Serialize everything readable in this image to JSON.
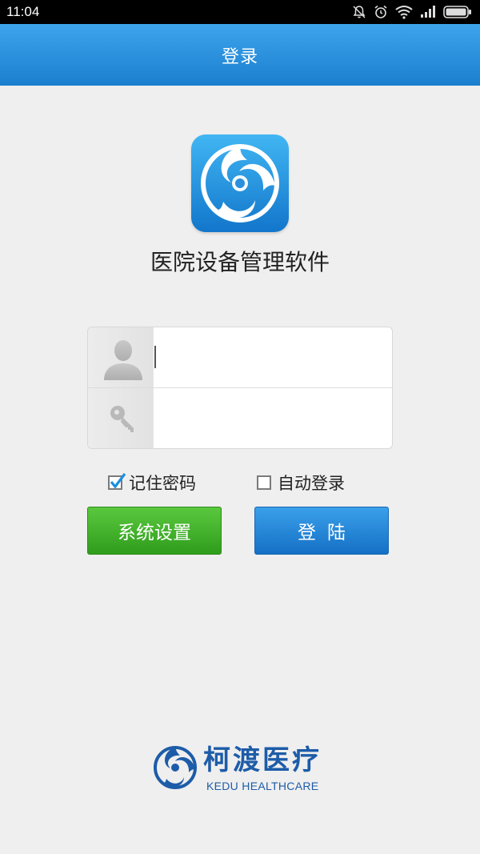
{
  "status_bar": {
    "time": "11:04",
    "icons": [
      "notifications-off-icon",
      "alarm-clock-icon",
      "wifi-icon",
      "signal-icon",
      "battery-icon"
    ]
  },
  "header": {
    "title": "登录"
  },
  "app": {
    "icon": "app-logo-icon",
    "name": "医院设备管理软件"
  },
  "login_form": {
    "username": {
      "icon": "user-icon",
      "value": "",
      "placeholder": ""
    },
    "password": {
      "icon": "key-icon",
      "value": "",
      "placeholder": ""
    }
  },
  "options": {
    "remember_password": {
      "label": "记住密码",
      "checked": true
    },
    "auto_login": {
      "label": "自动登录",
      "checked": false
    }
  },
  "buttons": {
    "settings": "系统设置",
    "login": "登陆"
  },
  "footer": {
    "brand_name": "柯渡医疗",
    "brand_english": "KEDU HEALTHCARE"
  },
  "colors": {
    "header_blue": "#2a8fdd",
    "login_blue": "#1e80d2",
    "settings_green": "#3db42a",
    "brand_blue": "#1d5ca8"
  }
}
